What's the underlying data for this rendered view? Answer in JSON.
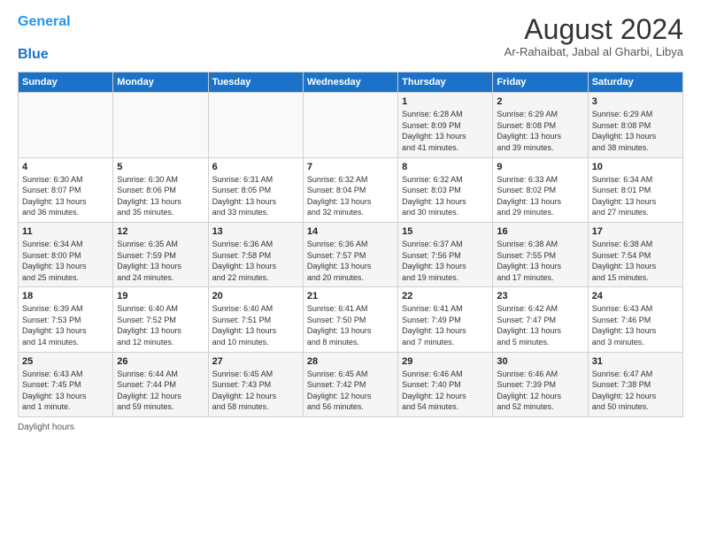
{
  "header": {
    "logo_line1": "General",
    "logo_line2": "Blue",
    "title": "August 2024",
    "subtitle": "Ar-Rahaibat, Jabal al Gharbi, Libya"
  },
  "days_of_week": [
    "Sunday",
    "Monday",
    "Tuesday",
    "Wednesday",
    "Thursday",
    "Friday",
    "Saturday"
  ],
  "weeks": [
    [
      {
        "day": "",
        "info": ""
      },
      {
        "day": "",
        "info": ""
      },
      {
        "day": "",
        "info": ""
      },
      {
        "day": "",
        "info": ""
      },
      {
        "day": "1",
        "info": "Sunrise: 6:28 AM\nSunset: 8:09 PM\nDaylight: 13 hours\nand 41 minutes."
      },
      {
        "day": "2",
        "info": "Sunrise: 6:29 AM\nSunset: 8:08 PM\nDaylight: 13 hours\nand 39 minutes."
      },
      {
        "day": "3",
        "info": "Sunrise: 6:29 AM\nSunset: 8:08 PM\nDaylight: 13 hours\nand 38 minutes."
      }
    ],
    [
      {
        "day": "4",
        "info": "Sunrise: 6:30 AM\nSunset: 8:07 PM\nDaylight: 13 hours\nand 36 minutes."
      },
      {
        "day": "5",
        "info": "Sunrise: 6:30 AM\nSunset: 8:06 PM\nDaylight: 13 hours\nand 35 minutes."
      },
      {
        "day": "6",
        "info": "Sunrise: 6:31 AM\nSunset: 8:05 PM\nDaylight: 13 hours\nand 33 minutes."
      },
      {
        "day": "7",
        "info": "Sunrise: 6:32 AM\nSunset: 8:04 PM\nDaylight: 13 hours\nand 32 minutes."
      },
      {
        "day": "8",
        "info": "Sunrise: 6:32 AM\nSunset: 8:03 PM\nDaylight: 13 hours\nand 30 minutes."
      },
      {
        "day": "9",
        "info": "Sunrise: 6:33 AM\nSunset: 8:02 PM\nDaylight: 13 hours\nand 29 minutes."
      },
      {
        "day": "10",
        "info": "Sunrise: 6:34 AM\nSunset: 8:01 PM\nDaylight: 13 hours\nand 27 minutes."
      }
    ],
    [
      {
        "day": "11",
        "info": "Sunrise: 6:34 AM\nSunset: 8:00 PM\nDaylight: 13 hours\nand 25 minutes."
      },
      {
        "day": "12",
        "info": "Sunrise: 6:35 AM\nSunset: 7:59 PM\nDaylight: 13 hours\nand 24 minutes."
      },
      {
        "day": "13",
        "info": "Sunrise: 6:36 AM\nSunset: 7:58 PM\nDaylight: 13 hours\nand 22 minutes."
      },
      {
        "day": "14",
        "info": "Sunrise: 6:36 AM\nSunset: 7:57 PM\nDaylight: 13 hours\nand 20 minutes."
      },
      {
        "day": "15",
        "info": "Sunrise: 6:37 AM\nSunset: 7:56 PM\nDaylight: 13 hours\nand 19 minutes."
      },
      {
        "day": "16",
        "info": "Sunrise: 6:38 AM\nSunset: 7:55 PM\nDaylight: 13 hours\nand 17 minutes."
      },
      {
        "day": "17",
        "info": "Sunrise: 6:38 AM\nSunset: 7:54 PM\nDaylight: 13 hours\nand 15 minutes."
      }
    ],
    [
      {
        "day": "18",
        "info": "Sunrise: 6:39 AM\nSunset: 7:53 PM\nDaylight: 13 hours\nand 14 minutes."
      },
      {
        "day": "19",
        "info": "Sunrise: 6:40 AM\nSunset: 7:52 PM\nDaylight: 13 hours\nand 12 minutes."
      },
      {
        "day": "20",
        "info": "Sunrise: 6:40 AM\nSunset: 7:51 PM\nDaylight: 13 hours\nand 10 minutes."
      },
      {
        "day": "21",
        "info": "Sunrise: 6:41 AM\nSunset: 7:50 PM\nDaylight: 13 hours\nand 8 minutes."
      },
      {
        "day": "22",
        "info": "Sunrise: 6:41 AM\nSunset: 7:49 PM\nDaylight: 13 hours\nand 7 minutes."
      },
      {
        "day": "23",
        "info": "Sunrise: 6:42 AM\nSunset: 7:47 PM\nDaylight: 13 hours\nand 5 minutes."
      },
      {
        "day": "24",
        "info": "Sunrise: 6:43 AM\nSunset: 7:46 PM\nDaylight: 13 hours\nand 3 minutes."
      }
    ],
    [
      {
        "day": "25",
        "info": "Sunrise: 6:43 AM\nSunset: 7:45 PM\nDaylight: 13 hours\nand 1 minute."
      },
      {
        "day": "26",
        "info": "Sunrise: 6:44 AM\nSunset: 7:44 PM\nDaylight: 12 hours\nand 59 minutes."
      },
      {
        "day": "27",
        "info": "Sunrise: 6:45 AM\nSunset: 7:43 PM\nDaylight: 12 hours\nand 58 minutes."
      },
      {
        "day": "28",
        "info": "Sunrise: 6:45 AM\nSunset: 7:42 PM\nDaylight: 12 hours\nand 56 minutes."
      },
      {
        "day": "29",
        "info": "Sunrise: 6:46 AM\nSunset: 7:40 PM\nDaylight: 12 hours\nand 54 minutes."
      },
      {
        "day": "30",
        "info": "Sunrise: 6:46 AM\nSunset: 7:39 PM\nDaylight: 12 hours\nand 52 minutes."
      },
      {
        "day": "31",
        "info": "Sunrise: 6:47 AM\nSunset: 7:38 PM\nDaylight: 12 hours\nand 50 minutes."
      }
    ]
  ],
  "footer": {
    "daylight_label": "Daylight hours"
  }
}
